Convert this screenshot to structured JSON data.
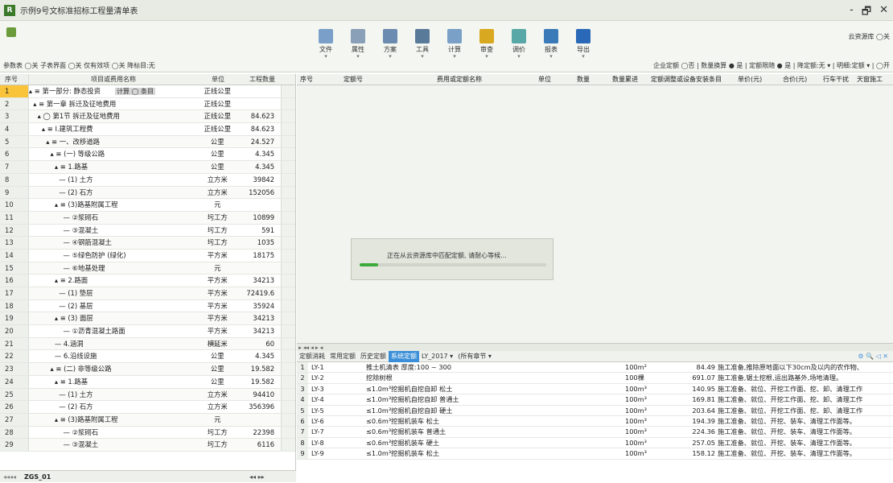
{
  "window": {
    "title": "示例9号文标准招标工程量清单表",
    "controls": [
      "-",
      "🗗",
      "✕"
    ]
  },
  "toolbar": {
    "buttons": [
      {
        "label": "文件",
        "color": "#7a9fc8"
      },
      {
        "label": "属性",
        "color": "#8aa0b8"
      },
      {
        "label": "方案",
        "color": "#6b8bb0"
      },
      {
        "label": "工具",
        "color": "#5a7a9a"
      },
      {
        "label": "计算",
        "color": "#7aa0c8"
      },
      {
        "label": "审查",
        "color": "#d8a820"
      },
      {
        "label": "调价",
        "color": "#58a8a8"
      },
      {
        "label": "报表",
        "color": "#3a7ab8"
      },
      {
        "label": "导出",
        "color": "#2a68b8"
      }
    ],
    "cloud": "云资源库 ◯关",
    "options": "参数表 ◯关  子表界面 ◯关  仅有效项 ◯关  降标目:无",
    "right_options": "企业定额 ◯否 | 数量换算 ● 是 | 定额限随 ● 是 | 降定额:无 ▾ | 明细:定额 ▾ | ◯开"
  },
  "left_table": {
    "headers": [
      "序号",
      "项目或费用名称",
      "单位",
      "工程数量"
    ],
    "badge": "计算 ◯ 条目",
    "rows": [
      {
        "no": "1",
        "name": "▴ ≡ 第一部分: 静态投资",
        "unit": "正线公里",
        "qty": ""
      },
      {
        "no": "2",
        "name": "  ▴ ≡ 第一章 拆迁及征地费用",
        "unit": "正线公里",
        "qty": ""
      },
      {
        "no": "3",
        "name": "    ▴ ◯ 第1节 拆迁及征地费用",
        "unit": "正线公里",
        "qty": "84.623"
      },
      {
        "no": "4",
        "name": "      ▴ ≡ Ⅰ.建筑工程费",
        "unit": "正线公里",
        "qty": "84.623"
      },
      {
        "no": "5",
        "name": "        ▴ ≡ 一、改移道路",
        "unit": "公里",
        "qty": "24.527"
      },
      {
        "no": "6",
        "name": "          ▴ ≡ (一) 等级公路",
        "unit": "公里",
        "qty": "4.345"
      },
      {
        "no": "7",
        "name": "            ▴ ≡ 1.路基",
        "unit": "公里",
        "qty": "4.345"
      },
      {
        "no": "8",
        "name": "              — (1) 土方",
        "unit": "立方米",
        "qty": "39842"
      },
      {
        "no": "9",
        "name": "              — (2) 石方",
        "unit": "立方米",
        "qty": "152056"
      },
      {
        "no": "10",
        "name": "            ▴ ≡ (3)路基附属工程",
        "unit": "元",
        "qty": ""
      },
      {
        "no": "11",
        "name": "                — ②浆砌石",
        "unit": "圬工方",
        "qty": "10899"
      },
      {
        "no": "12",
        "name": "                — ③混凝土",
        "unit": "圬工方",
        "qty": "591"
      },
      {
        "no": "13",
        "name": "                — ④钢筋混凝土",
        "unit": "圬工方",
        "qty": "1035"
      },
      {
        "no": "14",
        "name": "                — ⑤绿色防护 (绿化)",
        "unit": "平方米",
        "qty": "18175"
      },
      {
        "no": "15",
        "name": "                — ⑥地基处理",
        "unit": "元",
        "qty": ""
      },
      {
        "no": "16",
        "name": "            ▴ ≡ 2.路面",
        "unit": "平方米",
        "qty": "34213"
      },
      {
        "no": "17",
        "name": "              — (1) 垫层",
        "unit": "平方米",
        "qty": "72419.6"
      },
      {
        "no": "18",
        "name": "              — (2) 基层",
        "unit": "平方米",
        "qty": "35924"
      },
      {
        "no": "19",
        "name": "            ▴ ≡ (3) 面层",
        "unit": "平方米",
        "qty": "34213"
      },
      {
        "no": "20",
        "name": "                — ①沥青混凝土路面",
        "unit": "平方米",
        "qty": "34213"
      },
      {
        "no": "21",
        "name": "            — 4.涵洞",
        "unit": "横延米",
        "qty": "60"
      },
      {
        "no": "22",
        "name": "            — 6.沿线设施",
        "unit": "公里",
        "qty": "4.345"
      },
      {
        "no": "23",
        "name": "          ▴ ≡ (二) 非等级公路",
        "unit": "公里",
        "qty": "19.582"
      },
      {
        "no": "24",
        "name": "            ▴ ≡ 1.路基",
        "unit": "公里",
        "qty": "19.582"
      },
      {
        "no": "25",
        "name": "              — (1) 土方",
        "unit": "立方米",
        "qty": "94410"
      },
      {
        "no": "26",
        "name": "              — (2) 石方",
        "unit": "立方米",
        "qty": "356396"
      },
      {
        "no": "27",
        "name": "            ▴ ≡ (3)路基附属工程",
        "unit": "元",
        "qty": ""
      },
      {
        "no": "28",
        "name": "                — ②浆砌石",
        "unit": "圬工方",
        "qty": "22398"
      },
      {
        "no": "29",
        "name": "                — ③混凝土",
        "unit": "圬工方",
        "qty": "6116"
      }
    ],
    "footer": {
      "nav": "◂◂◂◂",
      "sheet": "ZGS_01",
      "nav2": "◂◂ ▸▸"
    }
  },
  "right_table": {
    "headers": [
      "序号",
      "定额号",
      "费用或定额名称",
      "单位",
      "数量",
      "数量累进",
      "定额调整或设备安装条目",
      "单价(元)",
      "合价(元)",
      "行车干扰",
      "天窗施工"
    ]
  },
  "loading": {
    "text": "正在从云资源库中匹配定额, 请耐心等候...",
    "progress": 0.1
  },
  "bottom": {
    "tabs": [
      "定额消耗",
      "常用定额",
      "历史定额",
      "系统定额",
      "LY_2017 ▾",
      "(所有章节 ▾"
    ],
    "active_tab": "系统定额",
    "tab_icons": "⚙ 🔍 ◁ ✕",
    "rows": [
      {
        "no": "1",
        "code": "LY-1",
        "name": "推土机清表 厚度:100 ~ 300",
        "unit": "100m²",
        "price": "84.49",
        "desc": "施工准备,推除原地面以下30cm及以内的农作物、"
      },
      {
        "no": "2",
        "code": "LY-2",
        "name": "挖除树根",
        "unit": "100棵",
        "price": "691.07",
        "desc": "施工准备,锯土挖根,运出路基外,场地清理。"
      },
      {
        "no": "3",
        "code": "LY-3",
        "name": "≤1.0m³挖掘机自挖自卸 松土",
        "unit": "100m³",
        "price": "140.95",
        "desc": "施工准备、就位、开挖工作面、挖、卸、清理工作"
      },
      {
        "no": "4",
        "code": "LY-4",
        "name": "≤1.0m³挖掘机自挖自卸 普通土",
        "unit": "100m³",
        "price": "169.81",
        "desc": "施工准备、就位、开挖工作面、挖、卸、清理工作"
      },
      {
        "no": "5",
        "code": "LY-5",
        "name": "≤1.0m³挖掘机自挖自卸 硬土",
        "unit": "100m³",
        "price": "203.64",
        "desc": "施工准备、就位、开挖工作面、挖、卸、清理工作"
      },
      {
        "no": "6",
        "code": "LY-6",
        "name": "≤0.6m³挖掘机装车 松土",
        "unit": "100m³",
        "price": "194.39",
        "desc": "施工准备、就位、开挖、装车、清理工作面等。"
      },
      {
        "no": "7",
        "code": "LY-7",
        "name": "≤0.6m³挖掘机装车 普通土",
        "unit": "100m³",
        "price": "224.36",
        "desc": "施工准备、就位、开挖、装车、清理工作面等。"
      },
      {
        "no": "8",
        "code": "LY-8",
        "name": "≤0.6m³挖掘机装车 硬土",
        "unit": "100m³",
        "price": "257.05",
        "desc": "施工准备、就位、开挖、装车、清理工作面等。"
      },
      {
        "no": "9",
        "code": "LY-9",
        "name": "≤1.0m³挖掘机装车 松土",
        "unit": "100m³",
        "price": "158.12",
        "desc": "施工准备、就位、开挖、装车、清理工作面等。"
      }
    ]
  }
}
